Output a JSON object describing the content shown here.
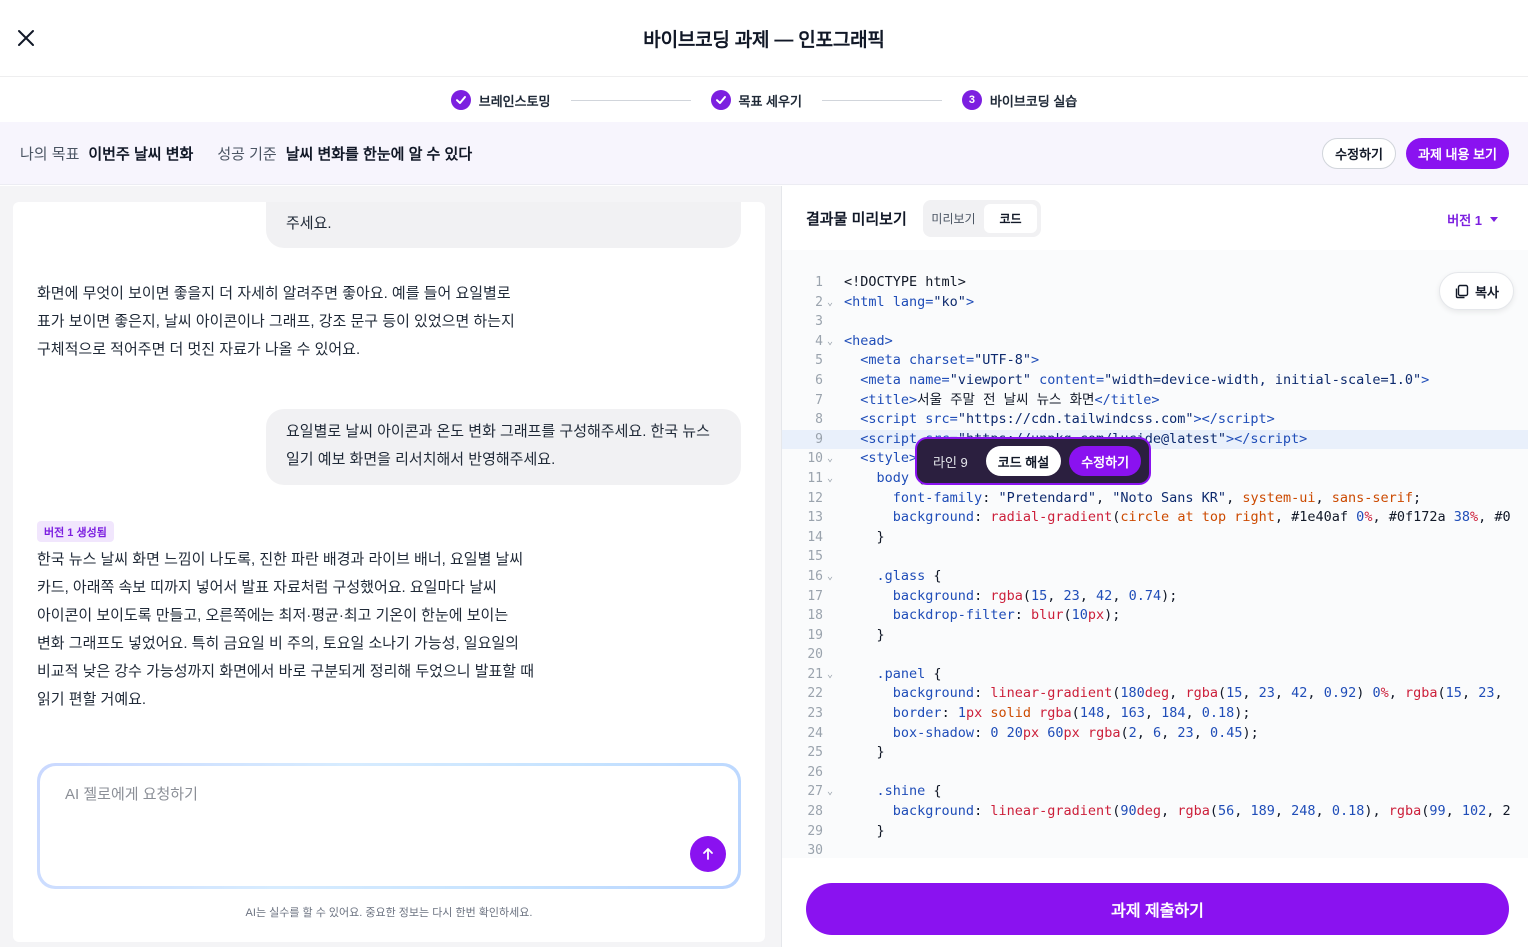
{
  "header": {
    "title": "바이브코딩 과제 — 인포그래픽"
  },
  "stepper": {
    "steps": [
      {
        "label": "브레인스토밍"
      },
      {
        "label": "목표 세우기"
      },
      {
        "number": "3",
        "label": "바이브코딩 실습"
      }
    ]
  },
  "goal": {
    "goal_key": "나의 목표",
    "goal_value": "이번주 날씨 변화",
    "criteria_key": "성공 기준",
    "criteria_value": "날씨 변화를 한눈에 알 수 있다",
    "edit_label": "수정하기",
    "view_label": "과제 내용 보기"
  },
  "chat": {
    "msg1_line1": "주세요.",
    "ai1": [
      "화면에 무엇이 보이면 좋을지 더 자세히 알려주면 좋아요. 예를 들어 요일별로",
      "표가 보이면 좋은지, 날씨 아이콘이나 그래프, 강조 문구 등이 있었으면 하는지",
      "구체적으로 적어주면 더 멋진 자료가 나올 수 있어요."
    ],
    "user2": [
      "요일별로 날씨 아이콘과 온도 변화 그래프를 구성해주세요. 한국 뉴스",
      "일기 예보 화면을 리서치해서 반영해주세요."
    ],
    "version_badge": "버전 1 생성됨",
    "ai2": [
      "한국 뉴스 날씨 화면 느낌이 나도록, 진한 파란 배경과 라이브 배너, 요일별 날씨",
      "카드, 아래쪽 속보 띠까지 넣어서 발표 자료처럼 구성했어요. 요일마다 날씨",
      "아이콘이 보이도록 만들고, 오른쪽에는 최저·평균·최고 기온이 한눈에 보이는",
      "변화 그래프도 넣었어요. 특히 금요일 비 주의, 토요일 소나기 가능성, 일요일의",
      "비교적 낮은 강수 가능성까지 화면에서 바로 구분되게 정리해 두었으니 발표할 때",
      "읽기 편할 거예요."
    ],
    "input_placeholder": "AI 젤로에게 요청하기",
    "disclaimer": "AI는 실수를 할 수 있어요. 중요한 정보는 다시 한번 확인하세요."
  },
  "preview": {
    "title": "결과물 미리보기",
    "tab_preview": "미리보기",
    "tab_code": "코드",
    "version": "버전 1",
    "copy_label": "복사",
    "tooltip_line": "라인  9",
    "tooltip_explain": "코드 해설",
    "tooltip_edit": "수정하기",
    "submit_label": "과제 제출하기"
  },
  "code": [
    "1",
    "2",
    "3",
    "4",
    "5",
    "6",
    "7",
    "8",
    "9",
    "10",
    "11",
    "12",
    "13",
    "14",
    "15",
    "16",
    "17",
    "18",
    "19",
    "20",
    "21",
    "22",
    "23",
    "24",
    "25",
    "26",
    "27",
    "28",
    "29",
    "30"
  ],
  "colors": {
    "accent": "#8a12f0",
    "highlight_line": "#e9f0fb"
  }
}
